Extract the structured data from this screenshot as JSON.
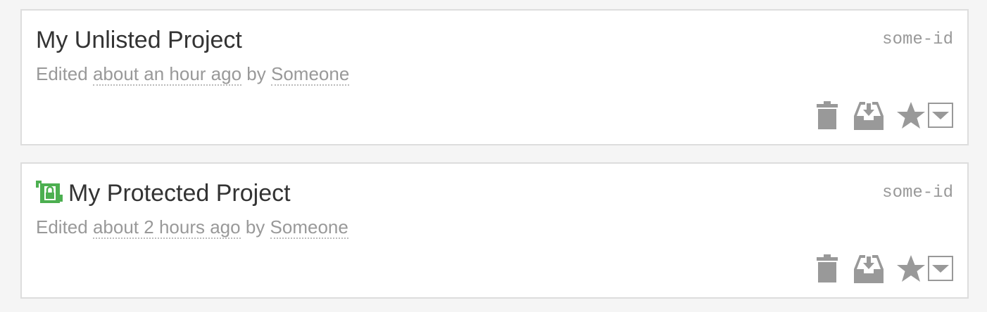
{
  "projects": [
    {
      "title": "My Unlisted Project",
      "id": "some-id",
      "edited_prefix": "Edited",
      "edited_time": "about an hour ago",
      "by_word": "by",
      "editor": "Someone",
      "protected": false
    },
    {
      "title": "My Protected Project",
      "id": "some-id",
      "edited_prefix": "Edited",
      "edited_time": "about 2 hours ago",
      "by_word": "by",
      "editor": "Someone",
      "protected": true
    }
  ],
  "icons": {
    "trash": "trash-icon",
    "archive": "archive-download-icon",
    "star": "star-icon",
    "dropdown": "caret-down-icon",
    "protected": "protected-lock-icon"
  },
  "colors": {
    "icon_gray": "#999999",
    "protected_green": "#4caf50",
    "title_text": "#333333",
    "meta_text": "#999999"
  }
}
